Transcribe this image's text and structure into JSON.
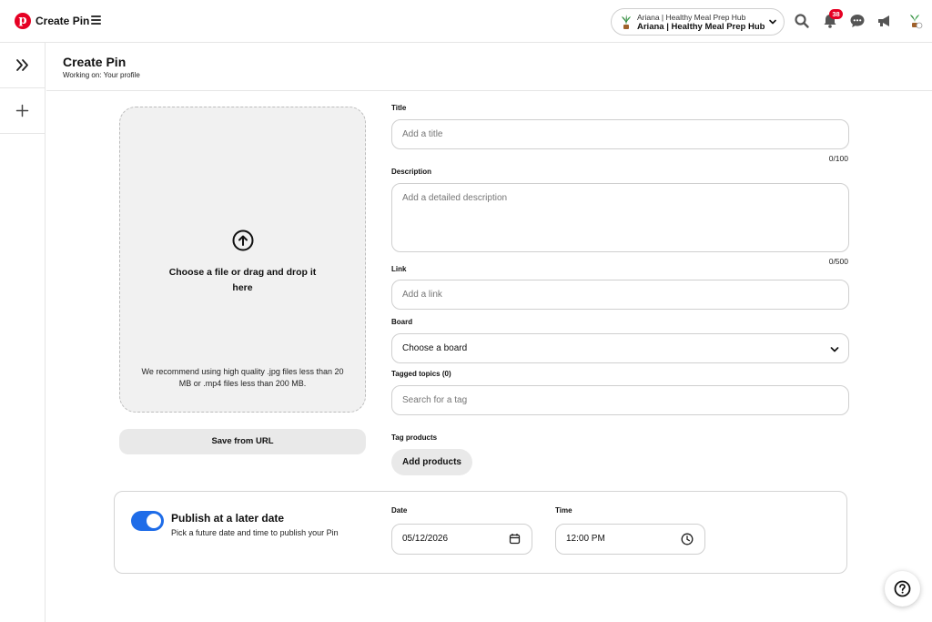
{
  "header": {
    "app_title": "Create Pin",
    "account_line1": "Ariana | Healthy Meal Prep Hub",
    "account_line2": "Ariana | Healthy Meal Prep Hub",
    "notification_count": "38"
  },
  "page": {
    "title": "Create Pin",
    "working_on": "Working on: Your profile"
  },
  "upload": {
    "prompt": "Choose a file or drag and drop it here",
    "recommendation": "We recommend using high quality .jpg files less than 20 MB or .mp4 files less than 200 MB.",
    "save_url_label": "Save from URL"
  },
  "form": {
    "title_label": "Title",
    "title_placeholder": "Add a title",
    "title_counter": "0/100",
    "description_label": "Description",
    "description_placeholder": "Add a detailed description",
    "description_counter": "0/500",
    "link_label": "Link",
    "link_placeholder": "Add a link",
    "board_label": "Board",
    "board_value": "Choose a board",
    "tagged_topics_label": "Tagged topics (0)",
    "tag_search_placeholder": "Search for a tag",
    "tag_products_label": "Tag products",
    "add_products_label": "Add products"
  },
  "publish": {
    "enabled": true,
    "title": "Publish at a later date",
    "subtitle": "Pick a future date and time to publish your Pin",
    "date_label": "Date",
    "date_value": "05/12/2026",
    "time_label": "Time",
    "time_value": "12:00 PM"
  },
  "colors": {
    "brand_red": "#e60023",
    "toggle_blue": "#1e6ce8"
  },
  "icons": [
    "pinterest-logo",
    "menu-icon",
    "plant-avatar-icon",
    "chevron-down-icon",
    "search-icon",
    "bell-icon",
    "message-icon",
    "megaphone-icon",
    "expand-icon",
    "plus-icon",
    "upload-arrow-icon",
    "calendar-icon",
    "clock-icon",
    "help-icon"
  ]
}
